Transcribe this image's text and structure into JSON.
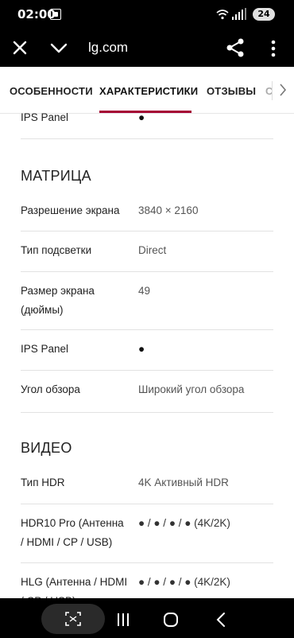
{
  "status_bar": {
    "time": "02:00",
    "battery": "24"
  },
  "browser": {
    "url": "lg.com"
  },
  "tabs": [
    {
      "label": "ОСОБЕННОСТИ"
    },
    {
      "label": "ХАРАКТЕРИСТИКИ"
    },
    {
      "label": "ОТЗЫВЫ"
    },
    {
      "label": "С"
    }
  ],
  "rows_top": [
    {
      "label": "IPS Panel",
      "value": "●"
    }
  ],
  "sections": [
    {
      "title": "МАТРИЦА",
      "rows": [
        {
          "label": "Разрешение экрана",
          "value": "3840 × 2160"
        },
        {
          "label": "Тип подсветки",
          "value": "Direct"
        },
        {
          "label": "Размер экрана",
          "label2": "(дюймы)",
          "value": "49"
        },
        {
          "label": "IPS Panel",
          "value": "●"
        },
        {
          "label": "Угол обзора",
          "value": "Широкий угол обзора"
        }
      ]
    },
    {
      "title": "ВИДЕО",
      "rows": [
        {
          "label": "Тип HDR",
          "value": "4K Активный HDR"
        },
        {
          "label": "HDR10 Pro (Антенна",
          "label2": "/ HDMI / CP / USB)",
          "value": "● / ● / ● / ● (4K/2K)"
        },
        {
          "label": "HLG (Антенна / HDMI",
          "label2": "/ CP / USB)",
          "value": "● / ● / ● / ● (4K/2K)"
        }
      ]
    }
  ],
  "colors": {
    "accent": "#a50034"
  }
}
